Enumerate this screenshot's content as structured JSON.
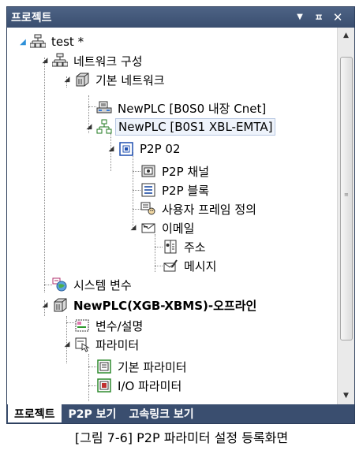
{
  "panel": {
    "title": "프로젝트",
    "buttons": {
      "dropdown": "▼",
      "pin": "ㅍ",
      "close": "✕"
    }
  },
  "tree": {
    "items": [
      {
        "label": "test *",
        "icon": "project-icon"
      },
      {
        "label": "네트워크 구성",
        "icon": "network-config-icon"
      },
      {
        "label": "기본 네트워크",
        "icon": "basic-network-icon"
      },
      {
        "label": "NewPLC [B0S0 내장 Cnet]",
        "icon": "plc-cnet-icon"
      },
      {
        "label": "NewPLC [B0S1 XBL-EMTA]",
        "icon": "plc-ethernet-icon"
      },
      {
        "label": "P2P 02",
        "icon": "p2p-icon"
      },
      {
        "label": "P2P 채널",
        "icon": "p2p-channel-icon"
      },
      {
        "label": "P2P 블록",
        "icon": "p2p-block-icon"
      },
      {
        "label": "사용자 프레임 정의",
        "icon": "user-frame-icon"
      },
      {
        "label": "이메일",
        "icon": "email-icon"
      },
      {
        "label": "주소",
        "icon": "address-book-icon"
      },
      {
        "label": "메시지",
        "icon": "message-icon"
      },
      {
        "label": "시스템 변수",
        "icon": "system-variable-icon"
      },
      {
        "label": "NewPLC(XGB-XBMS)-오프라인",
        "icon": "plc-cpu-icon"
      },
      {
        "label": "변수/설명",
        "icon": "variable-comment-icon"
      },
      {
        "label": "파라미터",
        "icon": "parameter-icon"
      },
      {
        "label": "기본 파라미터",
        "icon": "basic-parameter-icon"
      },
      {
        "label": "I/O 파라미터",
        "icon": "io-parameter-icon"
      }
    ]
  },
  "tabs": [
    {
      "label": "프로젝트"
    },
    {
      "label": "P2P 보기"
    },
    {
      "label": "고속링크 보기"
    }
  ],
  "scrollbar": {
    "up": "▲",
    "down": "▼",
    "grip": "≡"
  },
  "caption": "[그림 7-6] P2P 파라미터 설정 등록화면",
  "colors": {
    "titlebar": "#3a4e6f",
    "selection_border": "#b7c7e2",
    "tree_lines": "#8a8a8a",
    "expander_root": "#2d90d8"
  }
}
